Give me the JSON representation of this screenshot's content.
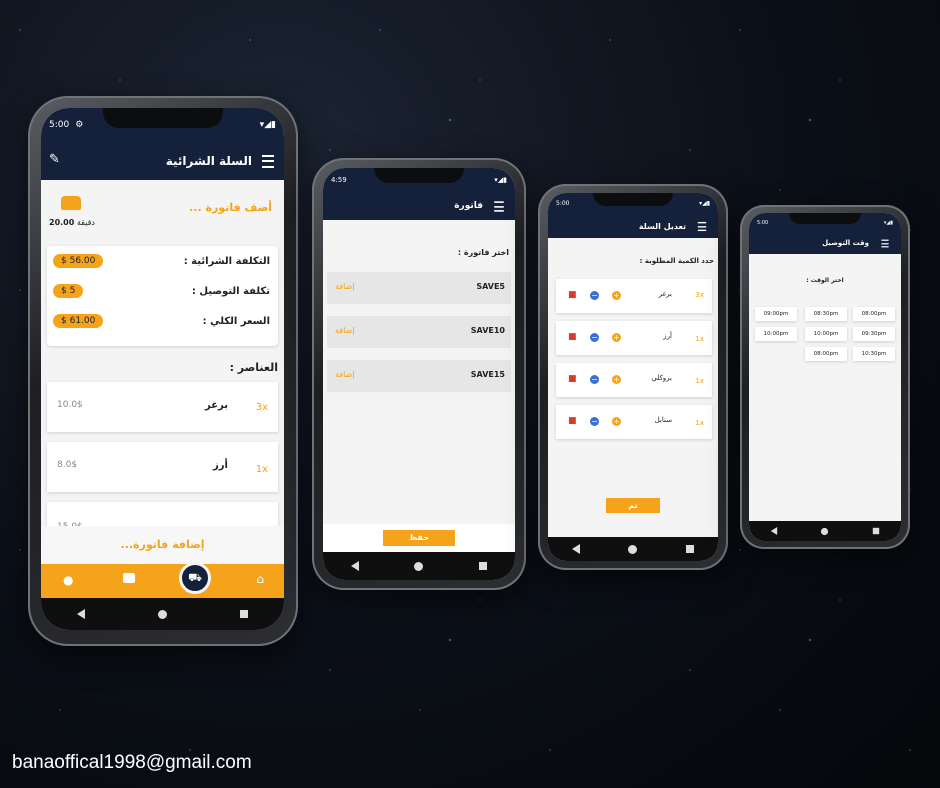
{
  "phone1": {
    "status_time": "5:00",
    "title": "السلة الشرائية",
    "add_invoice_top": "أضف فاتورة ...",
    "delivery_time": "20.00",
    "delivery_unit": "دقيقة",
    "summary": [
      {
        "label": "التكلفة الشرائية   :",
        "value": "$ 56.00"
      },
      {
        "label": "تكلفة التوصيل :",
        "value": "$ 5"
      },
      {
        "label": "السعر الكلي :",
        "value": "$ 61.00"
      }
    ],
    "items_heading": "العناصر :",
    "items": [
      {
        "name": "برغر",
        "qty": "3x",
        "price": "10.0$"
      },
      {
        "name": "أرز",
        "qty": "1x",
        "price": "8.0$"
      },
      {
        "name": "",
        "qty": "",
        "price": "15.0$"
      }
    ],
    "add_invoice_bottom": "إضافة فاتورة..."
  },
  "phone2": {
    "status_time": "4:59",
    "title": "فاتورة",
    "prompt": "اختر فاتورة :",
    "coupons": [
      {
        "code": "SAVE5",
        "action": "إضافة"
      },
      {
        "code": "SAVE10",
        "action": "إضافة"
      },
      {
        "code": "SAVE15",
        "action": "إضافة"
      }
    ],
    "save_button": "حفظ"
  },
  "phone3": {
    "status_time": "5:00",
    "title": "تعديل السلة",
    "prompt": "حدد الكمية المطلوبة :",
    "items": [
      {
        "name": "برغر",
        "qty": "3x"
      },
      {
        "name": "أرز",
        "qty": "1x"
      },
      {
        "name": "بروكلي",
        "qty": "1x"
      },
      {
        "name": "سنابل",
        "qty": "1x"
      }
    ],
    "done_button": "تم"
  },
  "phone4": {
    "status_time": "5:00",
    "title": "وقت التوصيل",
    "prompt": "اختر الوقت :",
    "times": [
      "08:00pm",
      "08:30pm",
      "09:00pm",
      "09:30pm",
      "10:00pm",
      "10:00pm",
      "10:30pm",
      "08:00pm"
    ]
  },
  "footer_email": "banaoffical1998@gmail.com",
  "colors": {
    "navy": "#15213b",
    "accent": "#f5a31a"
  }
}
